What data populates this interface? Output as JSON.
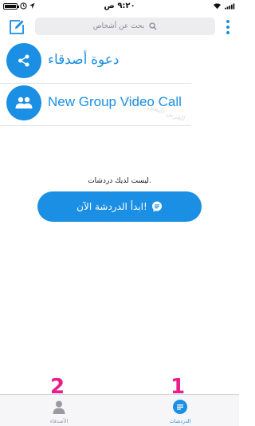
{
  "status_bar": {
    "time": "٩:٢٠ ص"
  },
  "header": {
    "search_placeholder": "بحث عن أشخاص"
  },
  "list": {
    "invite_label": "دعوة أصدقاء",
    "group_call_label": "New Group Video Call"
  },
  "watermark": "العربي التقني المؤلفة",
  "empty_state": {
    "message": "ليست لديك دردشات.",
    "button_label": "ابدأ الدردشة الآن!"
  },
  "tabs": [
    {
      "label": "الأصدقاء",
      "active": false
    },
    {
      "label": "الدردشات",
      "active": true
    }
  ],
  "annotations": {
    "marker_1": "1",
    "marker_2": "2"
  },
  "colors": {
    "accent": "#1a8fe3",
    "marker": "#e91e8c",
    "tab_inactive": "#9a9aa0"
  }
}
